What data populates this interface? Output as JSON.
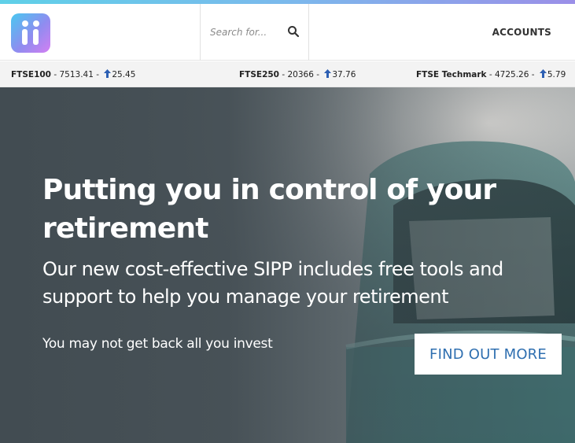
{
  "header": {
    "logo_alt": "ii",
    "search": {
      "placeholder": "Search for...",
      "value": ""
    },
    "accounts_label": "ACCOUNTS"
  },
  "ticker": [
    {
      "label": "FTSE100",
      "value": "7513.41",
      "change": "25.45",
      "direction": "up"
    },
    {
      "label": "FTSE250",
      "value": "20366",
      "change": "37.76",
      "direction": "up"
    },
    {
      "label": "FTSE Techmark",
      "value": "4725.26",
      "change": "5.79",
      "direction": "up"
    }
  ],
  "hero": {
    "title": "Putting you in control of your retirement",
    "subtitle": "Our new cost-effective SIPP includes free tools and support to help you manage your retirement",
    "risk_warning": "You may not get back all you invest",
    "cta_label": "FIND OUT MORE"
  },
  "colors": {
    "accent_gradient_start": "#5fd0e8",
    "accent_gradient_end": "#9b8fe8",
    "cta_text": "#2f6fb0",
    "ticker_arrow_up": "#2c5fb3",
    "hero_overlay": "#404a50"
  },
  "icons": {
    "search": "search-icon",
    "arrow_up": "arrow-up-icon"
  }
}
